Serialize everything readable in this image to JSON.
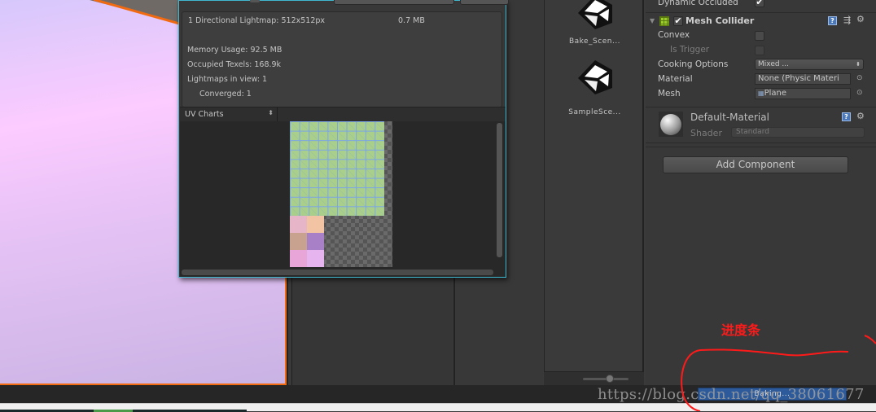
{
  "lighting": {
    "lightmap_line": "1 Directional Lightmap: 512x512px",
    "lightmap_size": "0.7 MB",
    "memory_usage": "Memory Usage: 92.5 MB",
    "occupied_texels": "Occupied Texels: 168.9k",
    "lightmaps_in_view": "Lightmaps in view: 1",
    "converged": "Converged: 1",
    "view_mode": "UV Charts"
  },
  "assets": [
    {
      "name": "Bake_Scen...",
      "icon": "unity-scene-icon"
    },
    {
      "name": "SampleSce...",
      "icon": "unity-scene-icon"
    }
  ],
  "inspector": {
    "dynamic_occluded_label": "Dynamic Occluded",
    "dynamic_occluded": true,
    "mesh_collider": {
      "title": "Mesh Collider",
      "enabled": true,
      "convex_label": "Convex",
      "convex": false,
      "is_trigger_label": "Is Trigger",
      "is_trigger": false,
      "cooking_options_label": "Cooking Options",
      "cooking_options_value": "Mixed ...",
      "material_label": "Material",
      "material_value": "None (Physic Materi",
      "mesh_label": "Mesh",
      "mesh_value": "Plane"
    },
    "material": {
      "name": "Default-Material",
      "shader_label": "Shader",
      "shader_value": "Standard"
    },
    "add_component": "Add Component"
  },
  "status": {
    "progress_label": "Baking...",
    "progress_color": "#2c5a9a"
  },
  "annotation": {
    "text": "进度条",
    "color": "#ff1a1a"
  },
  "watermark": "https://blog.csdn.net/qq_38061677"
}
